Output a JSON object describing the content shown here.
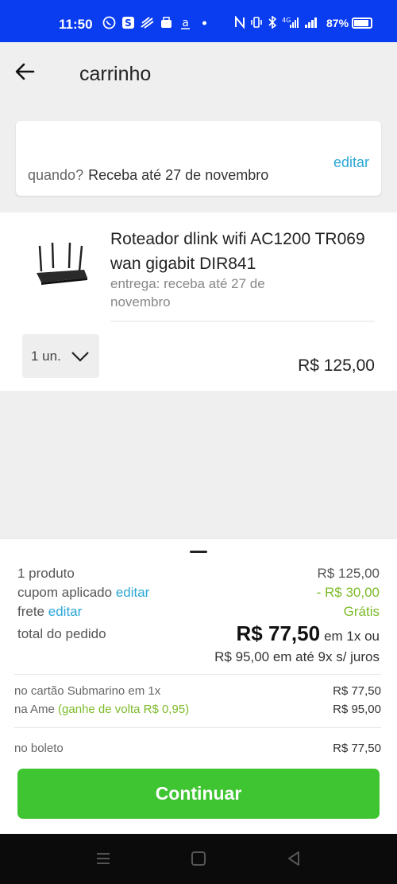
{
  "status_bar": {
    "time": "11:50",
    "battery": "87%",
    "icons": [
      "whatsapp-icon",
      "s-app-icon",
      "wave-icon",
      "bag-icon",
      "a-icon",
      "dot-icon",
      "nfc-icon",
      "vibrate-icon",
      "bluetooth-icon",
      "4g-signal-icon",
      "signal-icon",
      "battery-icon"
    ]
  },
  "header": {
    "title": "carrinho",
    "back_icon": "arrow-left-icon"
  },
  "delivery_card": {
    "edit_label": "editar",
    "when_label": "quando?",
    "when_value": "Receba até 27 de novembro"
  },
  "cart_item": {
    "name": "Roteador dlink wifi AC1200 TR069 wan gigabit DIR841",
    "delivery": "entrega: receba até 27 de novembro",
    "quantity": "1 un.",
    "price": "R$ 125,00"
  },
  "summary": {
    "products_label": "1 produto",
    "products_value": "R$ 125,00",
    "coupon_label": "cupom aplicado",
    "coupon_edit": "editar",
    "coupon_value": "- R$ 30,00",
    "shipping_label": "frete",
    "shipping_edit": "editar",
    "shipping_value": "Grátis",
    "total_label": "total do pedido",
    "total_value": "R$ 77,50",
    "total_suffix": "em 1x ou",
    "installments": "R$ 95,00 em até 9x s/ juros",
    "card_label": "no cartão Submarino em 1x",
    "card_value": "R$ 77,50",
    "ame_label": "na Ame",
    "ame_cashback": "(ganhe de volta R$ 0,95)",
    "ame_value": "R$ 95,00",
    "boleto_label": "no boleto",
    "boleto_value": "R$ 77,50",
    "continue_label": "Continuar"
  },
  "colors": {
    "status_bar": "#0a3cf0",
    "link": "#2ba7d6",
    "discount": "#7dbb2a",
    "primary_button": "#3ec531"
  }
}
